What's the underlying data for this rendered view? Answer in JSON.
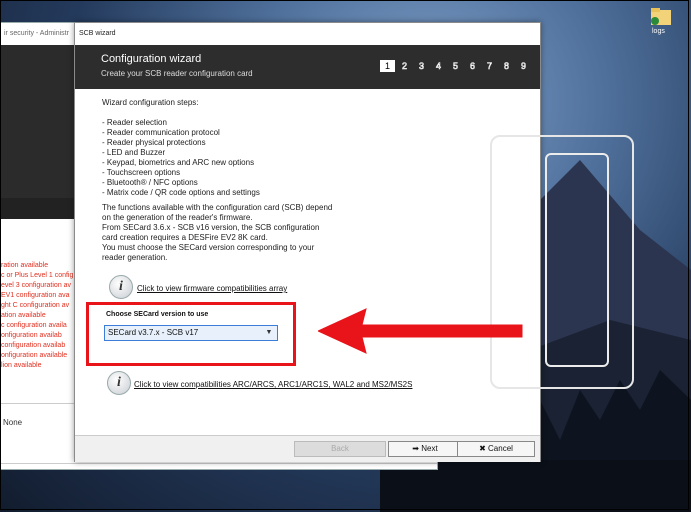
{
  "desktop": {
    "icon_label": "logs"
  },
  "background_window": {
    "title": "ir security - Administr",
    "red_items": [
      "ration available",
      "c or Plus Level 1 config",
      "evel 3 configuration av",
      "EV1 configuration ava",
      "ght C configuration av",
      "ation available",
      "c configuration availa",
      "onfiguration availab",
      "configuration availab",
      "onfiguration available",
      "lion available"
    ],
    "none_label": "None"
  },
  "wizard": {
    "window_title": "SCB wizard",
    "header_title": "Configuration wizard",
    "header_subtitle": "Create your SCB reader configuration card",
    "steps": [
      "1",
      "2",
      "3",
      "4",
      "5",
      "6",
      "7",
      "8",
      "9"
    ],
    "steps_intro": "Wizard configuration steps:",
    "step_items": [
      "- Reader selection",
      "- Reader communication protocol",
      "- Reader physical protections",
      "- LED and Buzzer",
      "- Keypad, biometrics and ARC new options",
      "- Touchscreen options",
      "- Bluetooth® / NFC options",
      "- Matrix code / QR code options and settings"
    ],
    "paragraph": [
      "The functions available with the configuration card (SCB) depend",
      "on the generation of the reader's firmware.",
      "From SECard 3.6.x - SCB v16 version, the SCB configuration",
      "card creation requires a DESFire EV2 8K card.",
      "You must choose the SECard version corresponding to your",
      "reader generation."
    ],
    "firmware_link": "Click to view firmware compatibilities array",
    "secard_label": "Choose SECard version to use",
    "secard_value": "SECard v3.7.x - SCB v17",
    "compat_link": "Click to view compatibilities ARC/ARCS, ARC1/ARC1S, WAL2 and MS2/MS2S",
    "back_label": "Back",
    "next_label": "Next",
    "cancel_label": "Cancel"
  },
  "colors": {
    "accent_red": "#e8141a",
    "header_dark": "#2d2d2d",
    "select_border": "#3b7dd8"
  }
}
